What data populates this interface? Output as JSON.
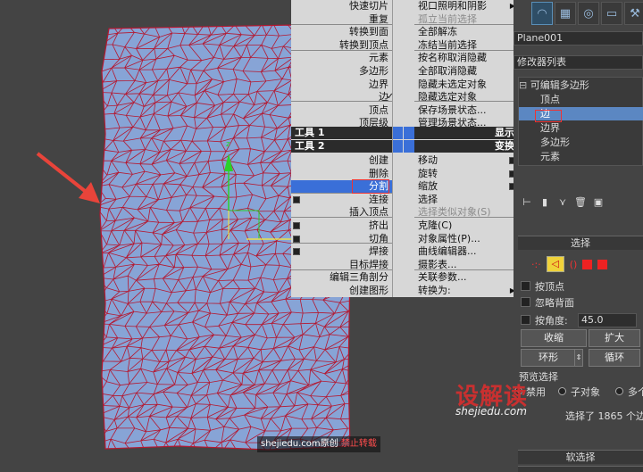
{
  "quad_left": {
    "title1": "工具 1",
    "title2": "工具 2",
    "items_top": [
      "快速切片",
      "重复",
      "转换到面",
      "转换到顶点",
      "元素",
      "多边形",
      "边界",
      "边",
      "顶点",
      "顶层级"
    ],
    "items_bottom": [
      "创建",
      "删除",
      "分割",
      "连接",
      "插入顶点",
      "挤出",
      "切角",
      "焊接",
      "目标焊接",
      "编辑三角剖分",
      "创建图形"
    ]
  },
  "quad_right": {
    "title1": "显示",
    "title2": "变换",
    "items_top": [
      "视口照明和阴影",
      "孤立当前选择",
      "全部解冻",
      "冻结当前选择",
      "按名称取消隐藏",
      "全部取消隐藏",
      "隐藏未选定对象",
      "隐藏选定对象",
      "保存场景状态...",
      "管理场景状态..."
    ],
    "items_bottom": [
      "移动",
      "旋转",
      "缩放",
      "选择",
      "选择类似对象(S)",
      "克隆(C)",
      "对象属性(P)...",
      "曲线编辑器...",
      "摄影表...",
      "关联参数...",
      "转换为:"
    ]
  },
  "panel": {
    "object_name": "Plane001",
    "modifier_list": "修改器列表",
    "stack": [
      "可编辑多边形",
      "顶点",
      "边",
      "边界",
      "多边形",
      "元素"
    ],
    "selection_title": "选择",
    "by_vertex": "按顶点",
    "ignore_backfacing": "忽略背面",
    "by_angle": "按角度:",
    "angle_value": "45.0",
    "shrink": "收缩",
    "grow": "扩大",
    "ring": "环形",
    "loop": "循环",
    "preview_title": "预览选择",
    "preview_off": "禁用",
    "preview_subobj": "子对象",
    "preview_multi": "多个",
    "status": "选择了 1865 个边",
    "soft_selection": "软选择"
  },
  "watermark": {
    "logo": "设解读",
    "url": "shejiedu.com",
    "bottom_site": "shejiedu.com",
    "bottom_original": "原创",
    "bottom_forbid": "禁止转载"
  },
  "colors": {
    "mesh_fill": "#87a4d6",
    "mesh_edge": "#b41830",
    "highlight": "#3a6fd8",
    "arrow": "#e8443a"
  }
}
